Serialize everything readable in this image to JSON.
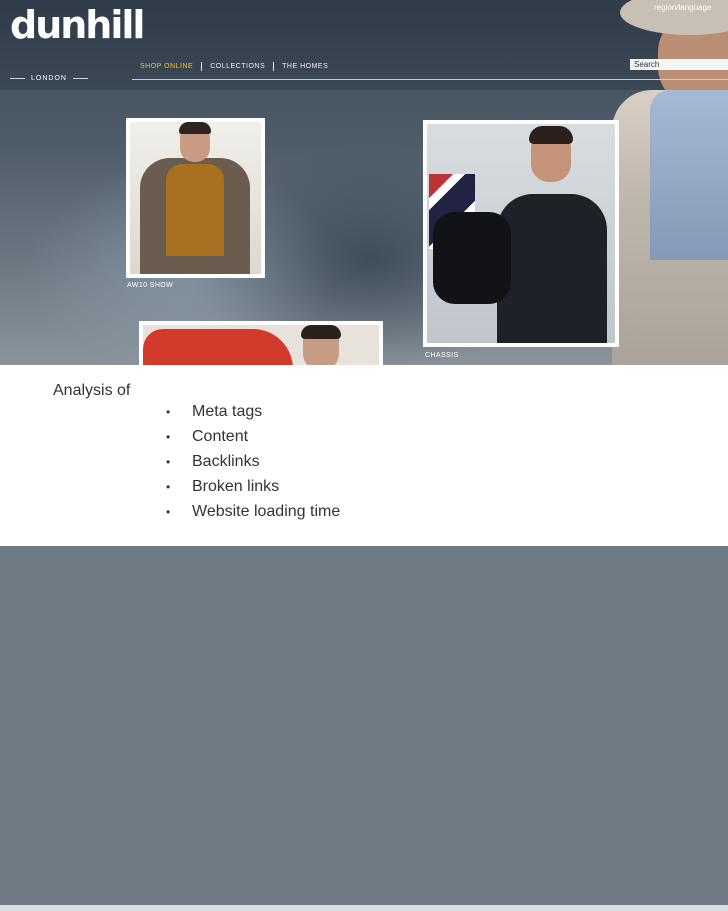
{
  "header": {
    "brand": "dunhill",
    "brand_sub": "LONDON",
    "region_language": "region/language",
    "search_placeholder": "Search",
    "nav": [
      {
        "label": "SHOP ONLINE",
        "active": true
      },
      {
        "label": "COLLECTIONS",
        "active": false
      },
      {
        "label": "THE HOMES",
        "active": false
      }
    ]
  },
  "gallery": {
    "captions": [
      "AW10 SHOW",
      "CHASSIS"
    ]
  },
  "slide": {
    "title": "Analysis of",
    "bullets": [
      "Meta tags",
      "Content",
      "Backlinks",
      "Broken links",
      "Website loading time"
    ],
    "bullet_symbol": "•"
  },
  "colors": {
    "nav_active": "#f1c232",
    "text": "#333333",
    "background_panel": "#ffffff"
  }
}
